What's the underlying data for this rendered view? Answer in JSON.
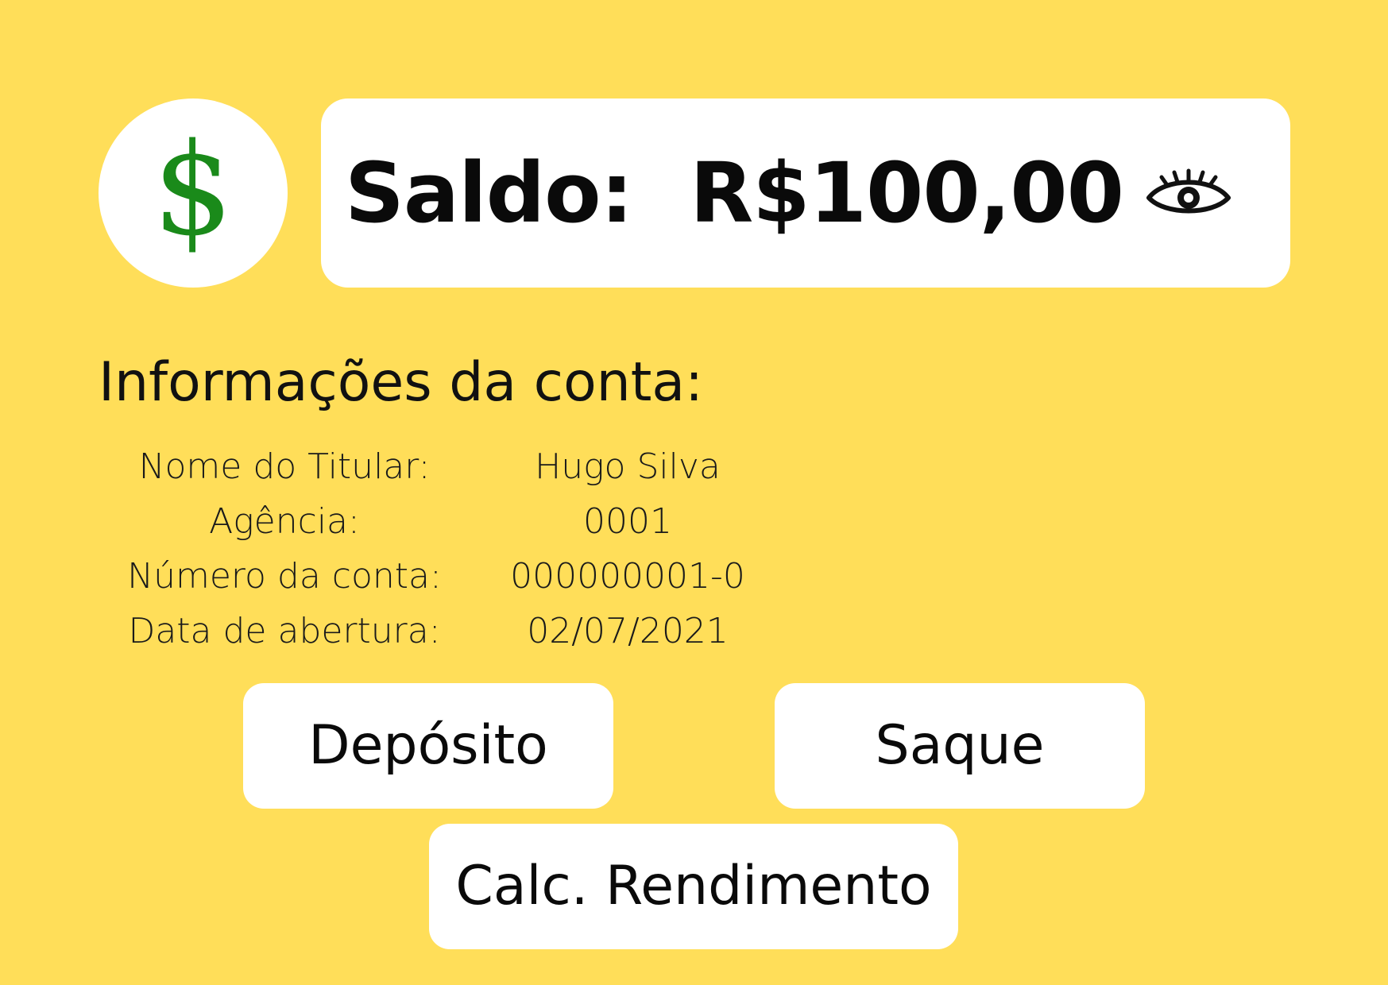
{
  "logo": {
    "symbol": "$",
    "icon": "dollar-icon",
    "color": "#1a8a1a"
  },
  "balance": {
    "label": "Saldo:",
    "value": "R$100,00",
    "visibility_icon": "eye-icon"
  },
  "account_info": {
    "title": "Informações da conta:",
    "rows": [
      {
        "label": "Nome do Titular:",
        "value": "Hugo Silva"
      },
      {
        "label": "Agência:",
        "value": "0001"
      },
      {
        "label": "Número da conta:",
        "value": "000000001-0"
      },
      {
        "label": "Data de abertura:",
        "value": "02/07/2021"
      }
    ]
  },
  "actions": {
    "deposit_label": "Depósito",
    "withdraw_label": "Saque",
    "yield_label": "Calc. Rendimento"
  },
  "theme": {
    "background": "#FFDE59",
    "card": "#FFFFFF"
  }
}
